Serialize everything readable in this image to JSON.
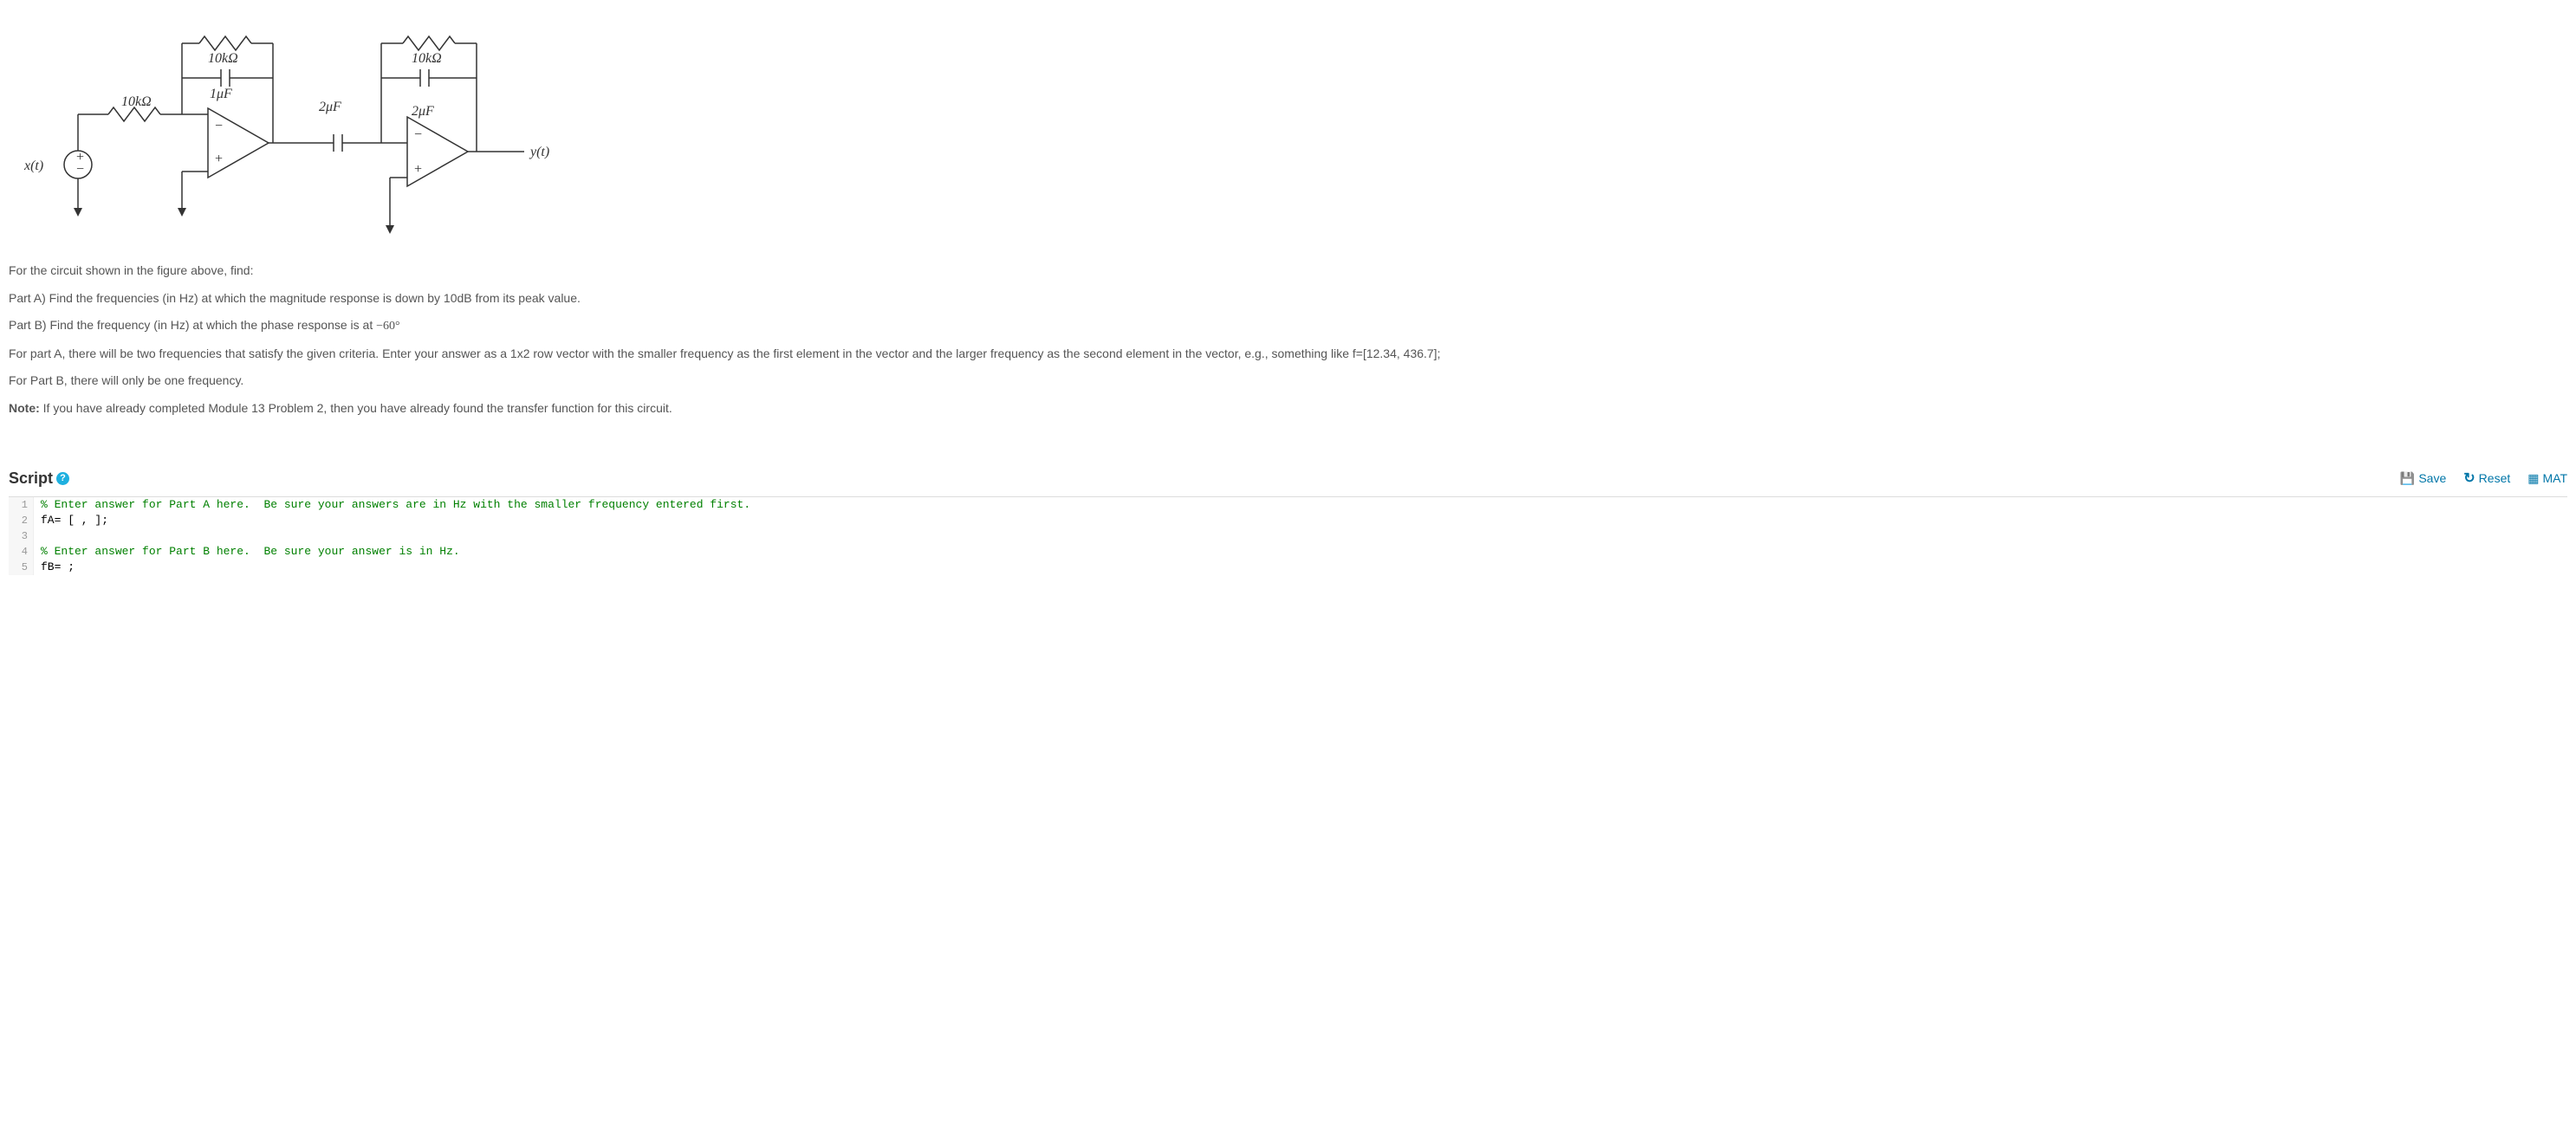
{
  "circuit": {
    "source_label": "x(t)",
    "output_label": "y(t)",
    "R_in": "10kΩ",
    "R_fb1": "10kΩ",
    "C_fb1": "1μF",
    "C_series": "2μF",
    "R_fb2": "10kΩ",
    "C_fb2": "2μF",
    "plus": "+",
    "minus": "−"
  },
  "problem": {
    "intro": "For the circuit shown in the figure above, find:",
    "partA": "Part A) Find the frequencies (in Hz) at which the magnitude response is down by 10dB from its peak value.",
    "partB_pre": "Part B) Find the frequency (in Hz) at which the phase response is at ",
    "partB_val": "−60°",
    "instrA": "For part A, there will be two frequencies that satisfy the given criteria.  Enter your answer as a 1x2 row vector with the smaller frequency as the first element in the vector and the larger frequency as the second element in the vector, e.g., something like f=[12.34, 436.7];",
    "instrB": "For Part B, there will only be one frequency.",
    "note_label": "Note:",
    "note_text": " If you have already completed Module 13 Problem 2, then you have already found the transfer function for this circuit."
  },
  "script": {
    "title": "Script",
    "help": "?",
    "actions": {
      "save": "Save",
      "reset": "Reset",
      "mat": "MAT"
    },
    "lines": [
      {
        "n": "1",
        "type": "comment",
        "text": "% Enter answer for Part A here.  Be sure your answers are in Hz with the smaller frequency entered first."
      },
      {
        "n": "2",
        "type": "code",
        "text": "fA= [ , ];"
      },
      {
        "n": "3",
        "type": "blank",
        "text": ""
      },
      {
        "n": "4",
        "type": "comment",
        "text": "% Enter answer for Part B here.  Be sure your answer is in Hz."
      },
      {
        "n": "5",
        "type": "code",
        "text": "fB= ;"
      }
    ]
  }
}
